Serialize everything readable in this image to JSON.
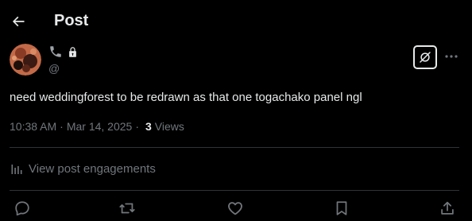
{
  "header": {
    "title": "Post"
  },
  "author": {
    "handle": "@"
  },
  "post": {
    "text": "need weddingforest to be redrawn as that one togachako panel ngl",
    "time": "10:38 AM",
    "date": "Mar 14, 2025",
    "separator": "·",
    "views_count": "3",
    "views_label": "Views"
  },
  "engagements": {
    "label": "View post engagements"
  },
  "colors": {
    "background": "#000000",
    "text_primary": "#e7e9ea",
    "text_secondary": "#71767b",
    "divider": "#2f3336"
  }
}
